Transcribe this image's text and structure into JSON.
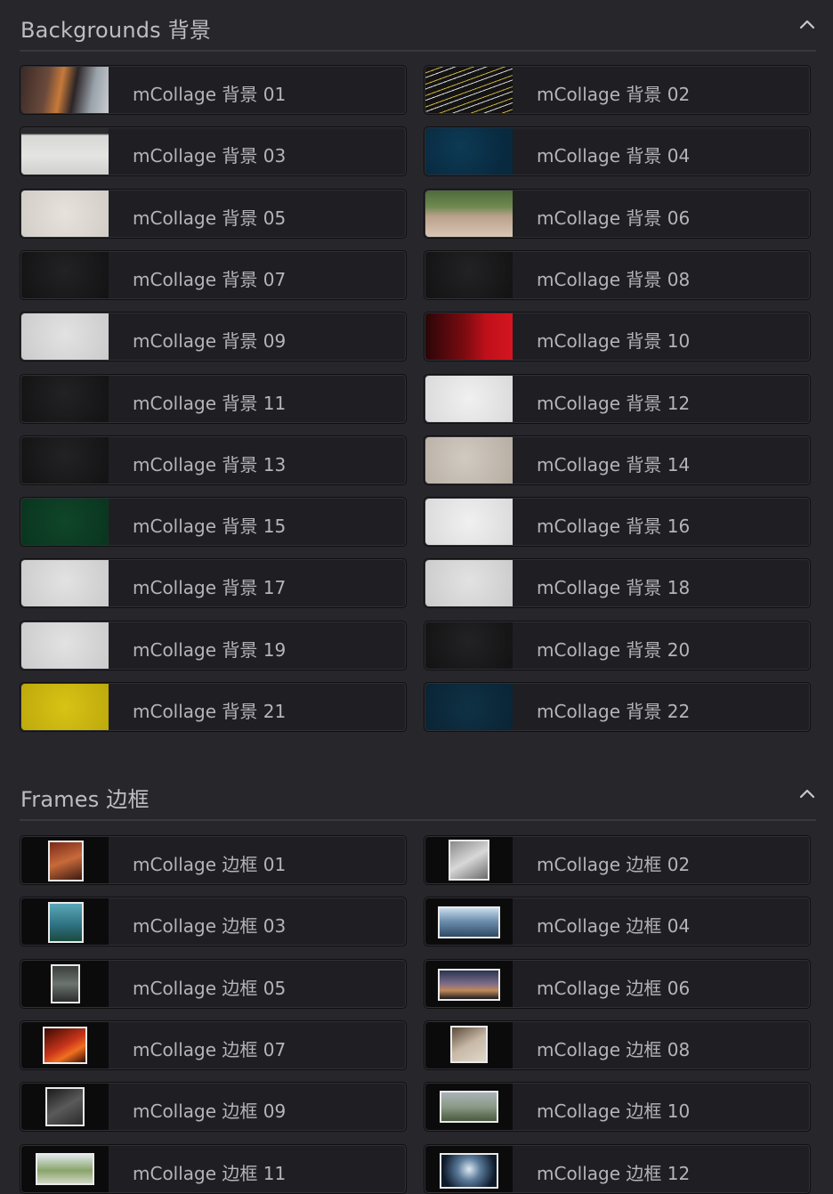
{
  "backgrounds": {
    "title": "Backgrounds 背景",
    "items": [
      {
        "label": "mCollage 背景 01",
        "thumb": "photo-woman-orange"
      },
      {
        "label": "mCollage 背景 02",
        "thumb": "typography-pattern"
      },
      {
        "label": "mCollage 背景 03",
        "thumb": "torn-paper"
      },
      {
        "label": "mCollage 背景 04",
        "thumb": "dark-teal"
      },
      {
        "label": "mCollage 背景 05",
        "thumb": "cream-paper"
      },
      {
        "label": "mCollage 背景 06",
        "thumb": "photo-basketball"
      },
      {
        "label": "mCollage 背景 07",
        "thumb": "black-texture"
      },
      {
        "label": "mCollage 背景 08",
        "thumb": "black-texture"
      },
      {
        "label": "mCollage 背景 09",
        "thumb": "light-gray-paper"
      },
      {
        "label": "mCollage 背景 10",
        "thumb": "red-gradient"
      },
      {
        "label": "mCollage 背景 11",
        "thumb": "black-texture"
      },
      {
        "label": "mCollage 背景 12",
        "thumb": "white-paper"
      },
      {
        "label": "mCollage 背景 13",
        "thumb": "black-texture"
      },
      {
        "label": "mCollage 背景 14",
        "thumb": "beige-paper"
      },
      {
        "label": "mCollage 背景 15",
        "thumb": "dark-green"
      },
      {
        "label": "mCollage 背景 16",
        "thumb": "white-paper"
      },
      {
        "label": "mCollage 背景 17",
        "thumb": "light-gray-paper"
      },
      {
        "label": "mCollage 背景 18",
        "thumb": "light-gray-paper"
      },
      {
        "label": "mCollage 背景 19",
        "thumb": "light-gray-paper"
      },
      {
        "label": "mCollage 背景 20",
        "thumb": "black-texture"
      },
      {
        "label": "mCollage 背景 21",
        "thumb": "yellow"
      },
      {
        "label": "mCollage 背景 22",
        "thumb": "dark-navy"
      }
    ]
  },
  "frames": {
    "title": "Frames 边框",
    "items": [
      {
        "label": "mCollage 边框 01",
        "thumb": "frame-portrait-food"
      },
      {
        "label": "mCollage 边框 02",
        "thumb": "frame-square-people"
      },
      {
        "label": "mCollage 边框 03",
        "thumb": "frame-portrait-lake"
      },
      {
        "label": "mCollage 边框 04",
        "thumb": "frame-landscape-ice"
      },
      {
        "label": "mCollage 边框 05",
        "thumb": "frame-portrait-person"
      },
      {
        "label": "mCollage 边框 06",
        "thumb": "frame-landscape-sunset"
      },
      {
        "label": "mCollage 边框 07",
        "thumb": "frame-landscape-fire"
      },
      {
        "label": "mCollage 边框 08",
        "thumb": "frame-square-hands"
      },
      {
        "label": "mCollage 边框 09",
        "thumb": "frame-square-film"
      },
      {
        "label": "mCollage 边框 10",
        "thumb": "frame-landscape-building"
      },
      {
        "label": "mCollage 边框 11",
        "thumb": "frame-landscape-grass"
      },
      {
        "label": "mCollage 边框 12",
        "thumb": "frame-landscape-tunnel"
      }
    ]
  },
  "icons": {
    "collapse": "chevron-up-icon"
  },
  "colors": {
    "background": "#26262b",
    "tile": "#1f1f23",
    "text": "#b4b4b9"
  }
}
